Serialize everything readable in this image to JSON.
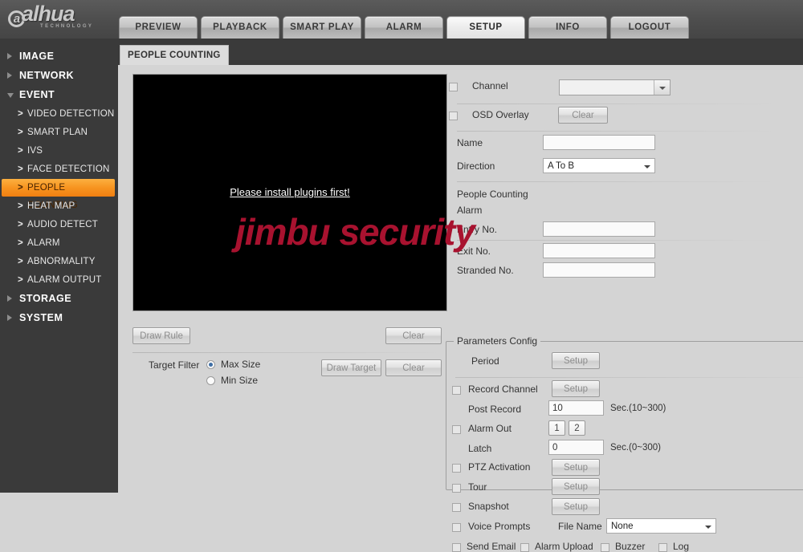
{
  "header": {
    "logo_text": "alhua",
    "logo_sub": "TECHNOLOGY",
    "tabs": [
      {
        "label": "PREVIEW",
        "active": false
      },
      {
        "label": "PLAYBACK",
        "active": false
      },
      {
        "label": "SMART PLAY",
        "active": false
      },
      {
        "label": "ALARM",
        "active": false
      },
      {
        "label": "SETUP",
        "active": true
      },
      {
        "label": "INFO",
        "active": false
      },
      {
        "label": "LOGOUT",
        "active": false
      }
    ]
  },
  "sidebar": {
    "items": [
      {
        "label": "IMAGE",
        "level": "top",
        "expanded": false
      },
      {
        "label": "NETWORK",
        "level": "top",
        "expanded": false
      },
      {
        "label": "EVENT",
        "level": "top",
        "expanded": true
      },
      {
        "label": "VIDEO DETECTION",
        "level": "sub",
        "selected": false
      },
      {
        "label": "SMART PLAN",
        "level": "sub",
        "selected": false
      },
      {
        "label": "IVS",
        "level": "sub",
        "selected": false
      },
      {
        "label": "FACE DETECTION",
        "level": "sub",
        "selected": false
      },
      {
        "label": "PEOPLE COUNTING",
        "level": "sub",
        "selected": true
      },
      {
        "label": "HEAT MAP",
        "level": "sub",
        "selected": false
      },
      {
        "label": "AUDIO DETECT",
        "level": "sub",
        "selected": false
      },
      {
        "label": "ALARM",
        "level": "sub",
        "selected": false
      },
      {
        "label": "ABNORMALITY",
        "level": "sub",
        "selected": false
      },
      {
        "label": "ALARM OUTPUT",
        "level": "sub",
        "selected": false
      },
      {
        "label": "STORAGE",
        "level": "top",
        "expanded": false
      },
      {
        "label": "SYSTEM",
        "level": "top",
        "expanded": false
      }
    ]
  },
  "breadcrumb": {
    "label": "PEOPLE COUNTING"
  },
  "video": {
    "message": "Please install plugins first!"
  },
  "watermark": {
    "text": "jimbu security",
    "color": "#a8122f"
  },
  "left_tools": {
    "draw_rule": "Draw Rule",
    "clear_rule": "Clear",
    "target_filter_label": "Target Filter",
    "max_size": "Max Size",
    "min_size": "Min Size",
    "selected_size": "Max Size",
    "draw_target": "Draw Target",
    "clear_target": "Clear"
  },
  "form": {
    "channel_label": "Channel",
    "channel_value": "",
    "channel_checked": false,
    "osd_overlay_label": "OSD Overlay",
    "osd_overlay_checked": false,
    "osd_clear_button": "Clear",
    "name_label": "Name",
    "name_value": "",
    "direction_label": "Direction",
    "direction_value": "A To B",
    "people_counting_label": "People Counting",
    "alarm_label": "Alarm",
    "entry_no_label": "Entry No.",
    "entry_no_value": "",
    "exit_no_label": "Exit No.",
    "exit_no_value": "",
    "stranded_no_label": "Stranded No.",
    "stranded_no_value": ""
  },
  "params": {
    "legend": "Parameters Config",
    "period_label": "Period",
    "period_button": "Setup",
    "record_channel_label": "Record Channel",
    "record_channel_button": "Setup",
    "record_channel_checked": false,
    "post_record_label": "Post Record",
    "post_record_value": "10",
    "post_record_unit": "Sec.(10~300)",
    "alarm_out_label": "Alarm Out",
    "alarm_out_checked": false,
    "alarm_out_1": "1",
    "alarm_out_2": "2",
    "latch_label": "Latch",
    "latch_value": "0",
    "latch_unit": "Sec.(0~300)",
    "ptz_activation_label": "PTZ Activation",
    "ptz_activation_button": "Setup",
    "ptz_activation_checked": false,
    "tour_label": "Tour",
    "tour_button": "Setup",
    "tour_checked": false,
    "snapshot_label": "Snapshot",
    "snapshot_button": "Setup",
    "snapshot_checked": false,
    "voice_prompts_label": "Voice Prompts",
    "voice_prompts_checked": false,
    "file_name_label": "File Name",
    "file_name_value": "None",
    "send_email_label": "Send Email",
    "send_email_checked": false,
    "alarm_upload_label": "Alarm Upload",
    "alarm_upload_checked": false,
    "buzzer_label": "Buzzer",
    "buzzer_checked": false,
    "log_label": "Log",
    "log_checked": false
  }
}
